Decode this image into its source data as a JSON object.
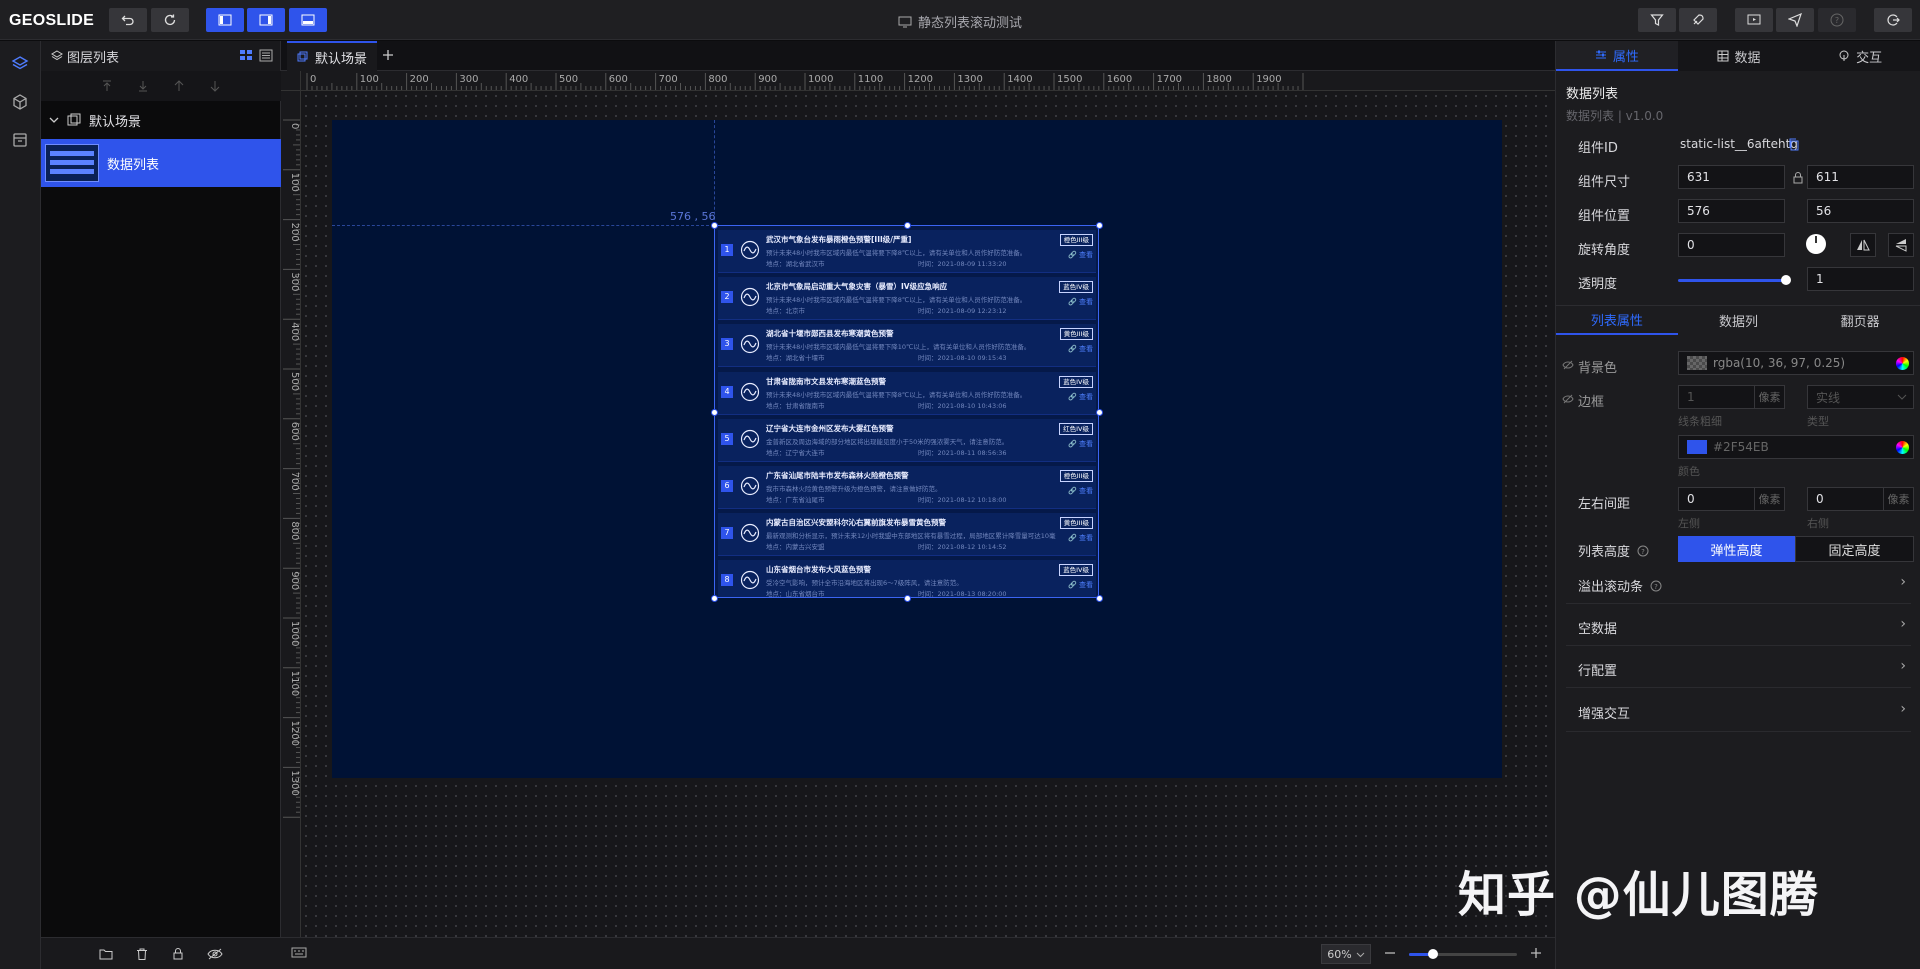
{
  "app": {
    "logo": "GEOSLIDE",
    "title": "静态列表滚动测试"
  },
  "layers": {
    "panel_title": "图层列表",
    "scene_name": "默认场景",
    "layer_item_label": "数据列表"
  },
  "workspace": {
    "tab_label": "默认场景",
    "h_ruler_ticks": [
      "0",
      "100",
      "200",
      "300",
      "400",
      "500",
      "600",
      "700",
      "800",
      "900",
      "1000",
      "1100",
      "1200",
      "1300",
      "1400",
      "1500",
      "1600",
      "1700",
      "1800",
      "1900"
    ],
    "v_ruler_ticks": [
      "0",
      "100",
      "200",
      "300",
      "400",
      "500",
      "600",
      "700",
      "800",
      "900",
      "1000",
      "1100",
      "1200",
      "1300"
    ],
    "position_label": "576 , 56",
    "zoom_label": "60%",
    "zoom_level_percent": 22
  },
  "list_component": {
    "view_label": "查看",
    "rows": [
      {
        "num": "1",
        "title": "武汉市气象台发布暴雨橙色预警[III级/严重]",
        "level": "橙色III级",
        "desc": "预计未来48小时我市区域内最低气温将要下降8℃以上，请有关单位和人员作好防范准备。",
        "location": "地点：湖北省武汉市",
        "time": "时间：2021-08-09 11:33:20"
      },
      {
        "num": "2",
        "title": "北京市气象局启动重大气象灾害（暴雪）IV级应急响应",
        "level": "蓝色IV级",
        "desc": "预计未来48小时我市区域内最低气温将要下降8℃以上，请有关单位和人员作好防范准备。",
        "location": "地点：北京市",
        "time": "时间：2021-08-09 12:23:12"
      },
      {
        "num": "3",
        "title": "湖北省十堰市郧西县发布寒潮黄色预警",
        "level": "黄色III级",
        "desc": "预计未来48小时我市区域内最低气温将要下降10℃以上，请有关单位和人员作好防范准备。",
        "location": "地点：湖北省十堰市",
        "time": "时间：2021-08-10 09:15:43"
      },
      {
        "num": "4",
        "title": "甘肃省陇南市文县发布寒潮蓝色预警",
        "level": "蓝色IV级",
        "desc": "预计未来48小时我市区域内最低气温将要下降8℃以上，请有关单位和人员作好防范准备。",
        "location": "地点：甘肃省陇南市",
        "time": "时间：2021-08-10 10:43:06"
      },
      {
        "num": "5",
        "title": "辽宁省大连市金州区发布大雾红色预警",
        "level": "红色IV级",
        "desc": "金普新区及周边海域的部分地区将出现能见度小于50米的强浓雾天气，请注意防范。",
        "location": "地点：辽宁省大连市",
        "time": "时间：2021-08-11 08:56:36"
      },
      {
        "num": "6",
        "title": "广东省汕尾市陆丰市发布森林火险橙色预警",
        "level": "橙色III级",
        "desc": "我市市森林火险黄色预警升级为橙色预警，请注意做好防范。",
        "location": "地点：广东省汕尾市",
        "time": "时间：2021-08-12 10:18:00"
      },
      {
        "num": "7",
        "title": "内蒙古自治区兴安盟科尔沁右翼前旗发布暴雪黄色预警",
        "level": "黄色III级",
        "desc": "最新观测和分析显示，预计未来12小时我盟中东部地区将有暴雪过程，局部地区累计降雪量可达10毫米以上。",
        "location": "地点：内蒙古兴安盟",
        "time": "时间：2021-08-12 10:14:52"
      },
      {
        "num": "8",
        "title": "山东省烟台市发布大风蓝色预警",
        "level": "蓝色IV级",
        "desc": "受冷空气影响，预计全市沿海地区将出现6～7级阵风，请注意防范。",
        "location": "地点：山东省烟台市",
        "time": "时间：2021-08-13 08:20:00"
      }
    ]
  },
  "properties": {
    "tabs": [
      "属性",
      "数据",
      "交互"
    ],
    "component_name": "数据列表",
    "component_version": "数据列表 | v1.0.0",
    "id_label": "组件ID",
    "id_value": "static-list__6aftehtg",
    "size_label": "组件尺寸",
    "width": "631",
    "height": "611",
    "pos_label": "组件位置",
    "x": "576",
    "y": "56",
    "rot_label": "旋转角度",
    "rotation": "0",
    "opacity_label": "透明度",
    "opacity": "1",
    "opacity_level": 1,
    "sub_tabs": [
      "列表属性",
      "数据列",
      "翻页器"
    ],
    "bg_label": "背景色",
    "bg_value": "rgba(10, 36, 97, 0.25)",
    "border_label": "边框",
    "border_width": "1",
    "px_unit": "像素",
    "border_width_caption": "线条粗细",
    "border_type": "实线",
    "border_type_caption": "类型",
    "border_color": "#2F54EB",
    "border_color_caption": "颜色",
    "margin_label": "左右间距",
    "margin_left": "0",
    "margin_left_caption": "左侧",
    "margin_right": "0",
    "margin_right_caption": "右侧",
    "height_label": "列表高度",
    "height_opt_flex": "弹性高度",
    "height_opt_fixed": "固定高度",
    "sections": [
      "溢出滚动条",
      "空数据",
      "行配置",
      "增强交互"
    ]
  },
  "colors": {
    "accent": "#2f54eb",
    "stage": "#001235",
    "panel": "#1c1c1f"
  },
  "watermark": "知乎 @仙儿图腾"
}
